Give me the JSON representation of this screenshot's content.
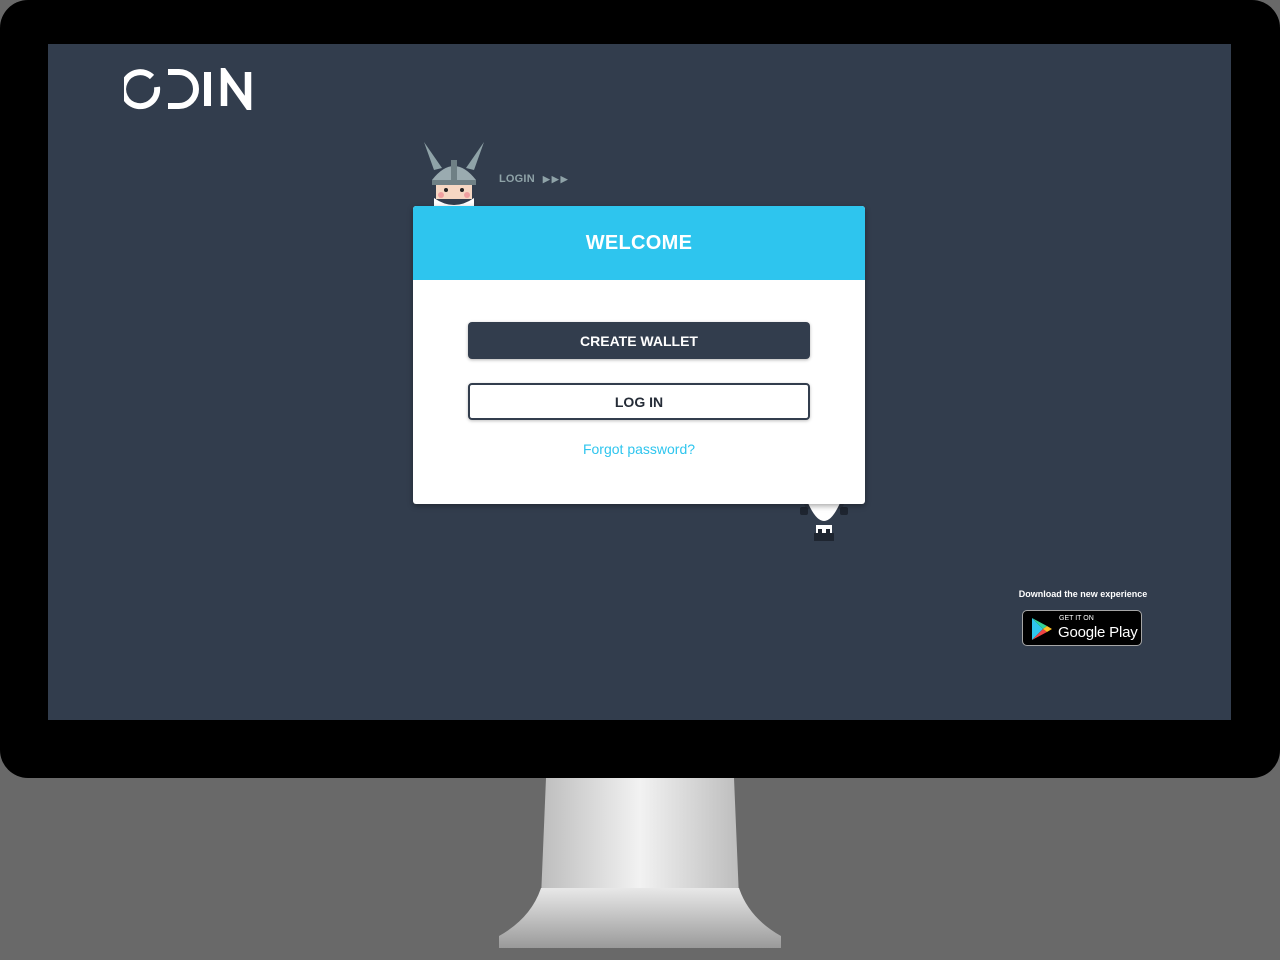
{
  "brand": {
    "logo_text": "ODIN"
  },
  "breadcrumb": {
    "label": "LOGIN",
    "arrows": "▶▶▶"
  },
  "card": {
    "title": "WELCOME",
    "create_wallet_label": "CREATE WALLET",
    "login_label": "LOG IN",
    "forgot_password_label": "Forgot password?"
  },
  "download": {
    "text": "Download the new experience",
    "store_small": "GET IT ON",
    "store_big": "Google Play"
  },
  "colors": {
    "screen_bg": "#323d4d",
    "accent": "#2ec5ee",
    "primary_button": "#323d4d",
    "breadcrumb": "#8fa3a8"
  },
  "icons": {
    "logo": "odin-logo",
    "mascot_top": "viking-mascot-icon",
    "mascot_bottom": "viking-mascot-icon",
    "store": "google-play-icon"
  }
}
